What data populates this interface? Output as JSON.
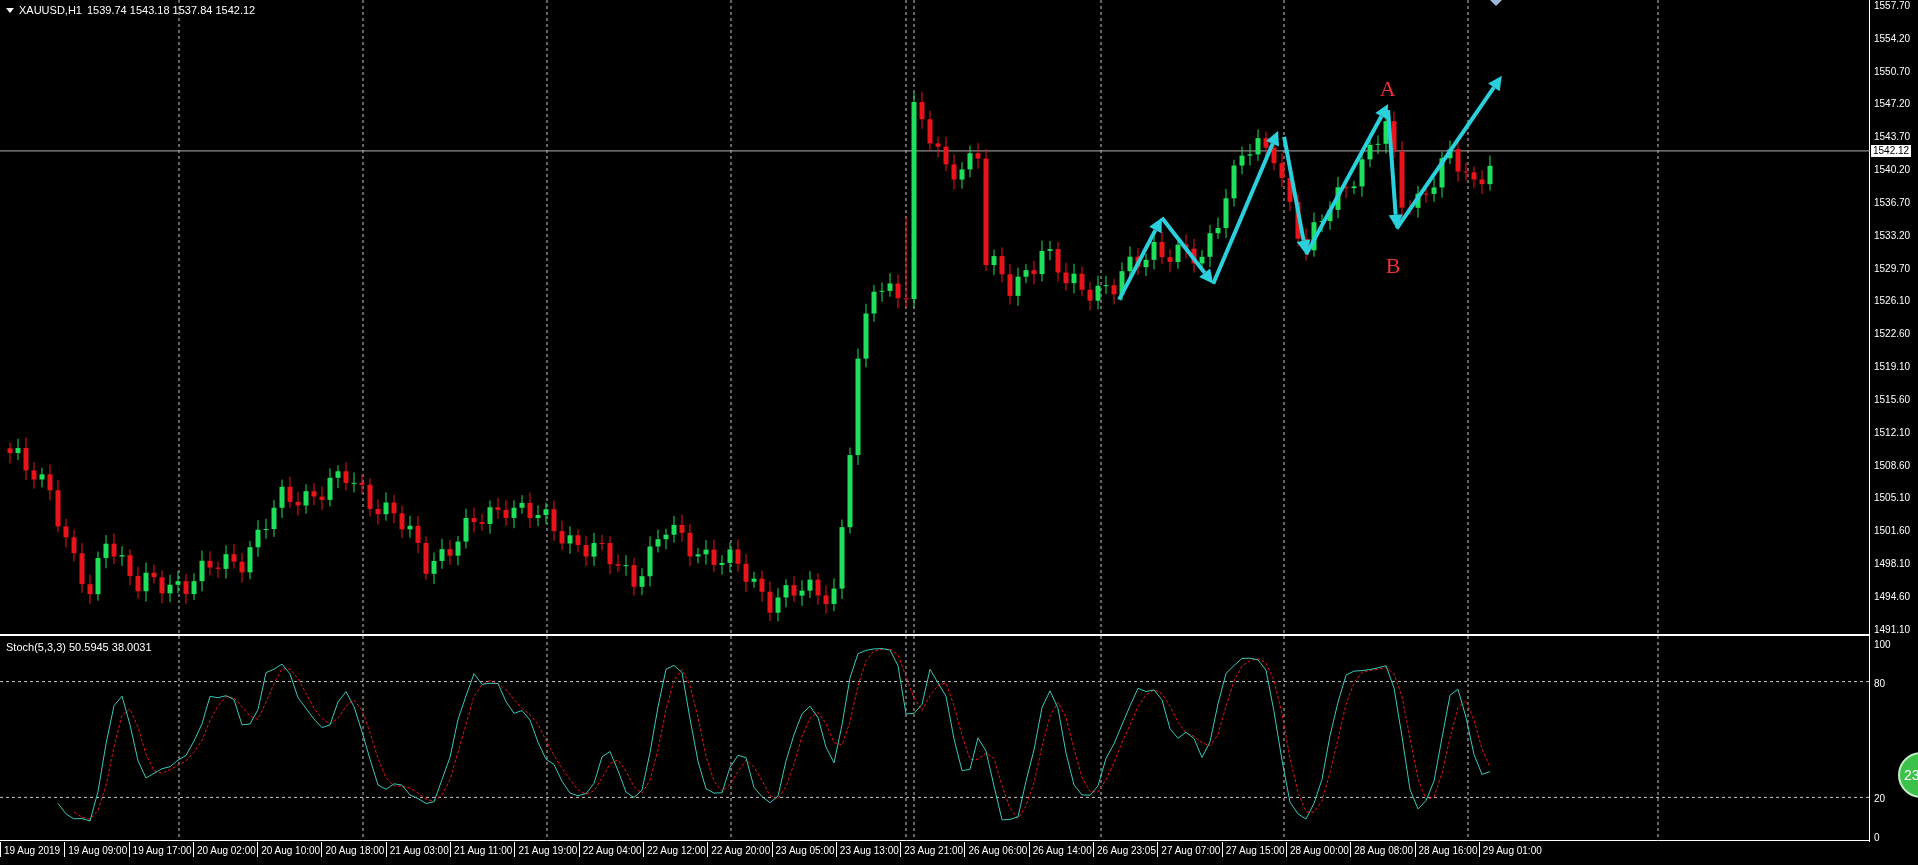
{
  "chart": {
    "title": "XAUUSD,H1",
    "quote": "1539.74 1543.18 1537.84 1542.12",
    "current_price": "1542.12",
    "labels": [
      {
        "text": "A"
      },
      {
        "text": "B"
      }
    ],
    "price_axis": [
      "1557.70",
      "1554.20",
      "1550.70",
      "1547.20",
      "1543.70",
      "1540.20",
      "1536.70",
      "1533.20",
      "1529.70",
      "1526.10",
      "1522.60",
      "1519.10",
      "1515.60",
      "1512.10",
      "1508.60",
      "1505.10",
      "1501.60",
      "1498.10",
      "1494.60",
      "1491.10"
    ]
  },
  "indicator": {
    "title": "Stoch(5,3,3) 50.5945 38.0031",
    "axis": [
      "100",
      "80",
      "20",
      "0"
    ]
  },
  "time_axis": [
    "19 Aug 2019",
    "19 Aug 09:00",
    "19 Aug 17:00",
    "20 Aug 02:00",
    "20 Aug 10:00",
    "20 Aug 18:00",
    "21 Aug 03:00",
    "21 Aug 11:00",
    "21 Aug 19:00",
    "22 Aug 04:00",
    "22 Aug 12:00",
    "22 Aug 20:00",
    "23 Aug 05:00",
    "23 Aug 13:00",
    "23 Aug 21:00",
    "26 Aug 06:00",
    "26 Aug 14:00",
    "26 Aug 23:05",
    "27 Aug 07:00",
    "27 Aug 15:00",
    "28 Aug 00:00",
    "28 Aug 08:00",
    "28 Aug 16:00",
    "29 Aug 01:00"
  ],
  "badge": "23"
}
